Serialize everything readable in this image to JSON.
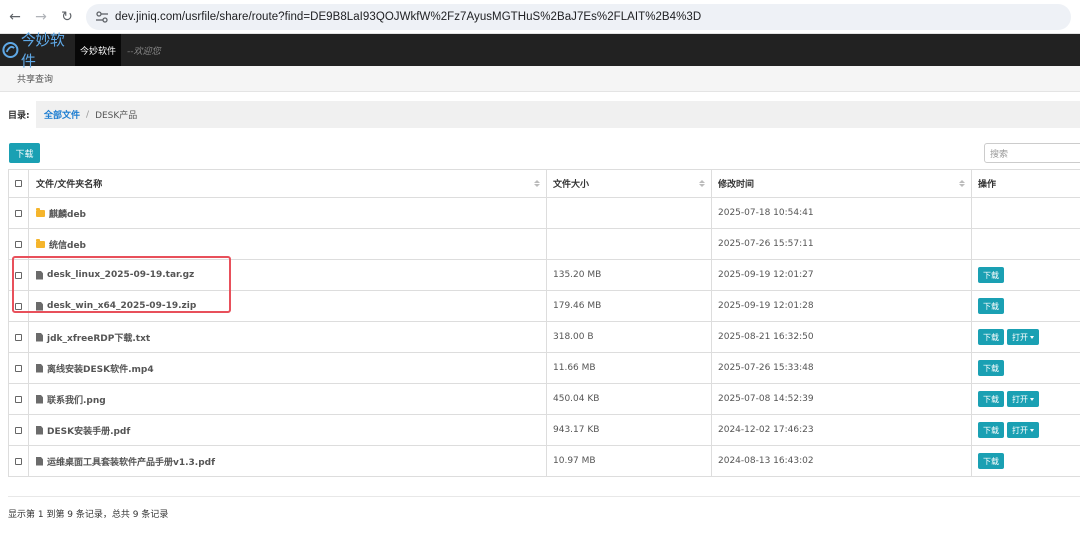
{
  "browser": {
    "url": "dev.jiniq.com/usrfile/share/route?find=DE9B8LaI93QOJWkfW%2Fz7AyusMGTHuS%2BaJ7Es%2FLAIT%2B4%3D"
  },
  "app": {
    "logo_text": "今妙软件",
    "nav_label": "今妙软件",
    "welcome": "--欢迎您"
  },
  "breadcrumb_bar": "共享查询",
  "directory": {
    "label": "目录:",
    "root": "全部文件",
    "separator": "/",
    "current": "DESK产品"
  },
  "toolbar": {
    "download_label": "下载",
    "search_placeholder": "搜索"
  },
  "table": {
    "headers": {
      "name": "文件/文件夹名称",
      "size": "文件大小",
      "time": "修改时间",
      "ops": "操作"
    },
    "rows": [
      {
        "type": "folder",
        "name": "麒麟deb",
        "size": "",
        "time": "2025-07-18 10:54:41",
        "download": "",
        "open": ""
      },
      {
        "type": "folder",
        "name": "统信deb",
        "size": "",
        "time": "2025-07-26 15:57:11",
        "download": "",
        "open": ""
      },
      {
        "type": "file",
        "name": "desk_linux_2025-09-19.tar.gz",
        "size": "135.20 MB",
        "time": "2025-09-19 12:01:27",
        "download": "下载",
        "open": ""
      },
      {
        "type": "file",
        "name": "desk_win_x64_2025-09-19.zip",
        "size": "179.46 MB",
        "time": "2025-09-19 12:01:28",
        "download": "下载",
        "open": ""
      },
      {
        "type": "file",
        "name": "jdk_xfreeRDP下载.txt",
        "size": "318.00 B",
        "time": "2025-08-21 16:32:50",
        "download": "下载",
        "open": "打开"
      },
      {
        "type": "file",
        "name": "离线安装DESK软件.mp4",
        "size": "11.66 MB",
        "time": "2025-07-26 15:33:48",
        "download": "下载",
        "open": ""
      },
      {
        "type": "file",
        "name": "联系我们.png",
        "size": "450.04 KB",
        "time": "2025-07-08 14:52:39",
        "download": "下载",
        "open": "打开"
      },
      {
        "type": "file",
        "name": "DESK安装手册.pdf",
        "size": "943.17 KB",
        "time": "2024-12-02 17:46:23",
        "download": "下载",
        "open": "打开"
      },
      {
        "type": "file",
        "name": "运维桌面工具套装软件产品手册v1.3.pdf",
        "size": "10.97 MB",
        "time": "2024-08-13 16:43:02",
        "download": "下载",
        "open": ""
      }
    ]
  },
  "footer": "显示第 1 到第 9 条记录，总共 9 条记录",
  "colors": {
    "accent": "#1aa0b3",
    "link": "#1c7dd1",
    "highlight": "#e8505b",
    "header_bg": "#222222"
  }
}
